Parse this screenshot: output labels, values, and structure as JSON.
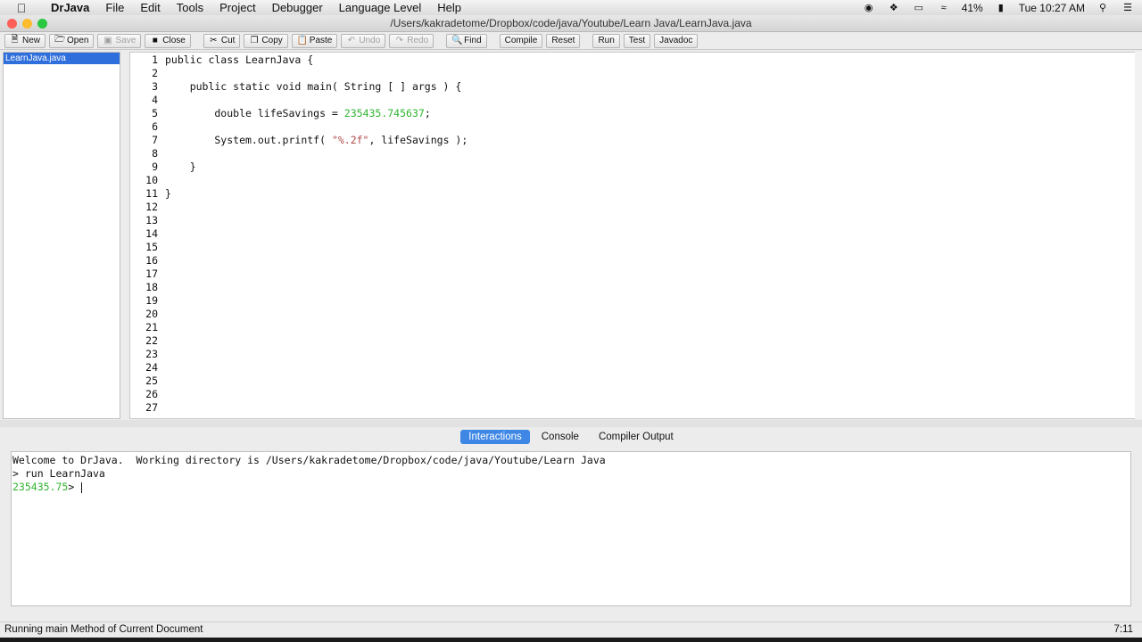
{
  "menubar": {
    "app_name": "DrJava",
    "items": [
      "File",
      "Edit",
      "Tools",
      "Project",
      "Debugger",
      "Language Level",
      "Help"
    ],
    "battery": "41%",
    "clock": "Tue 10:27 AM"
  },
  "window": {
    "title": "/Users/kakradetome/Dropbox/code/java/Youtube/Learn Java/LearnJava.java",
    "traffic_colors": [
      "#fc5f57",
      "#fdbc2e",
      "#2ac840"
    ]
  },
  "toolbar": {
    "new": "New",
    "open": "Open",
    "save": "Save",
    "close": "Close",
    "cut": "Cut",
    "copy": "Copy",
    "paste": "Paste",
    "undo": "Undo",
    "redo": "Redo",
    "find": "Find",
    "compile": "Compile",
    "reset": "Reset",
    "run": "Run",
    "test": "Test",
    "javadoc": "Javadoc"
  },
  "documents": [
    "LearnJava.java"
  ],
  "editor": {
    "lines": [
      "1",
      "2",
      "3",
      "4",
      "5",
      "6",
      "7",
      "8",
      "9",
      "10",
      "11",
      "12",
      "13",
      "14",
      "15",
      "16",
      "17",
      "18",
      "19",
      "20",
      "21",
      "22",
      "23",
      "24",
      "25",
      "26",
      "27"
    ],
    "code": {
      "l1": "public class LearnJava {",
      "l3": "    public static void main( String [ ] args ) {",
      "l5_pre": "        double lifeSavings = ",
      "l5_num": "235435.745637",
      "l5_post": ";",
      "l7_pre": "        System.out.printf( ",
      "l7_str": "\"%.2f\"",
      "l7_post": ", lifeSavings );",
      "l9": "    }",
      "l11": "}"
    }
  },
  "bottom_tabs": {
    "interactions": "Interactions",
    "console": "Console",
    "compiler_output": "Compiler Output"
  },
  "console": {
    "welcome": "Welcome to DrJava.  Working directory is /Users/kakradetome/Dropbox/code/java/Youtube/Learn Java",
    "command": "> run LearnJava",
    "output": "235435.75",
    "prompt": "> "
  },
  "statusbar": {
    "text": "Running main Method of Current Document",
    "position": "7:11"
  },
  "colors": {
    "accent": "#3f87e5",
    "number": "#2fb52f",
    "string": "#b04a4a",
    "selection": "#2f6fdc"
  }
}
